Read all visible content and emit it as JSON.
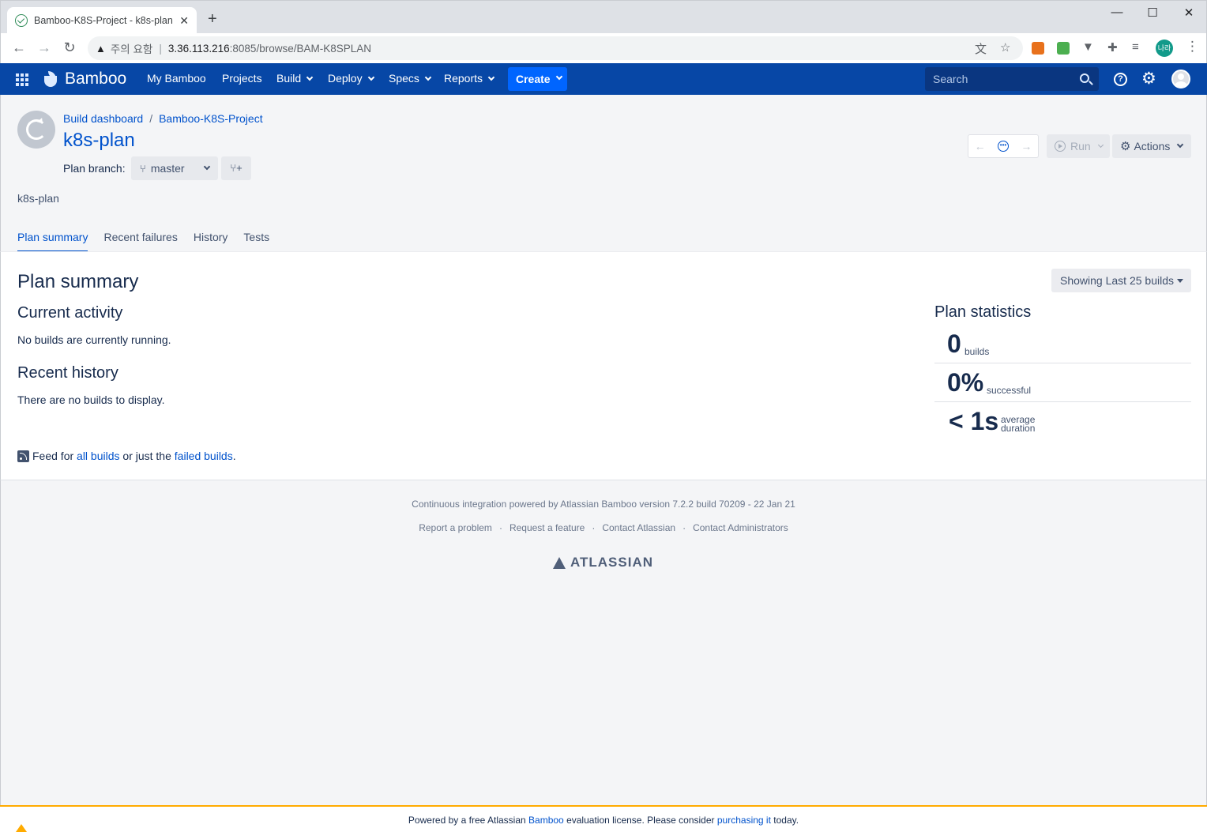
{
  "browser": {
    "tab_title": "Bamboo-K8S-Project - k8s-plan",
    "tab_close": "✕",
    "new_tab": "+",
    "security_label": "주의 요함",
    "url_host": "3.36.113.216",
    "url_path": ":8085/browse/BAM-K8SPLAN",
    "profile_initials": "나라"
  },
  "header": {
    "brand": "Bamboo",
    "nav": [
      "My Bamboo",
      "Projects",
      "Build",
      "Deploy",
      "Specs",
      "Reports"
    ],
    "create_label": "Create",
    "search_placeholder": "Search",
    "help_glyph": "?",
    "gear_glyph": "⚙"
  },
  "page": {
    "breadcrumbs": [
      "Build dashboard",
      "Bamboo-K8S-Project"
    ],
    "breadcrumb_sep": "/",
    "plan_title": "k8s-plan",
    "branch_label": "Plan branch:",
    "branch_value": "master",
    "description": "k8s-plan",
    "tabs": [
      "Plan summary",
      "Recent failures",
      "History",
      "Tests"
    ],
    "run_label": "Run",
    "actions_label": "Actions",
    "prev_glyph": "←",
    "next_glyph": "→"
  },
  "main": {
    "heading": "Plan summary",
    "showing_label": "Showing Last 25 builds",
    "current_activity_heading": "Current activity",
    "current_activity_text": "No builds are currently running.",
    "recent_history_heading": "Recent history",
    "recent_history_text": "There are no builds to display.",
    "feed": {
      "prefix": "Feed for",
      "all_builds": "all builds",
      "middle": "or just the",
      "failed_builds": "failed builds",
      "suffix": "."
    },
    "stats": {
      "heading": "Plan statistics",
      "builds_value": "0",
      "builds_label": "builds",
      "success_value": "0%",
      "success_label": "successful",
      "duration_value": "< 1s",
      "duration_label_1": "average",
      "duration_label_2": "duration"
    }
  },
  "footer": {
    "powered_by": "Continuous integration powered by Atlassian Bamboo version 7.2.2 build 70209 - 22 Jan 21",
    "links": [
      "Report a problem",
      "Request a feature",
      "Contact Atlassian",
      "Contact Administrators"
    ],
    "brand": "ATLASSIAN"
  },
  "license": {
    "prefix": "Powered by a free Atlassian",
    "bamboo_link": "Bamboo",
    "middle": "evaluation license. Please consider",
    "purchase_link": "purchasing it",
    "suffix": "today."
  },
  "colors": {
    "header_bg": "#0747a6",
    "create_bg": "#0065ff",
    "link": "#0052cc",
    "license_border": "#ffab00"
  }
}
